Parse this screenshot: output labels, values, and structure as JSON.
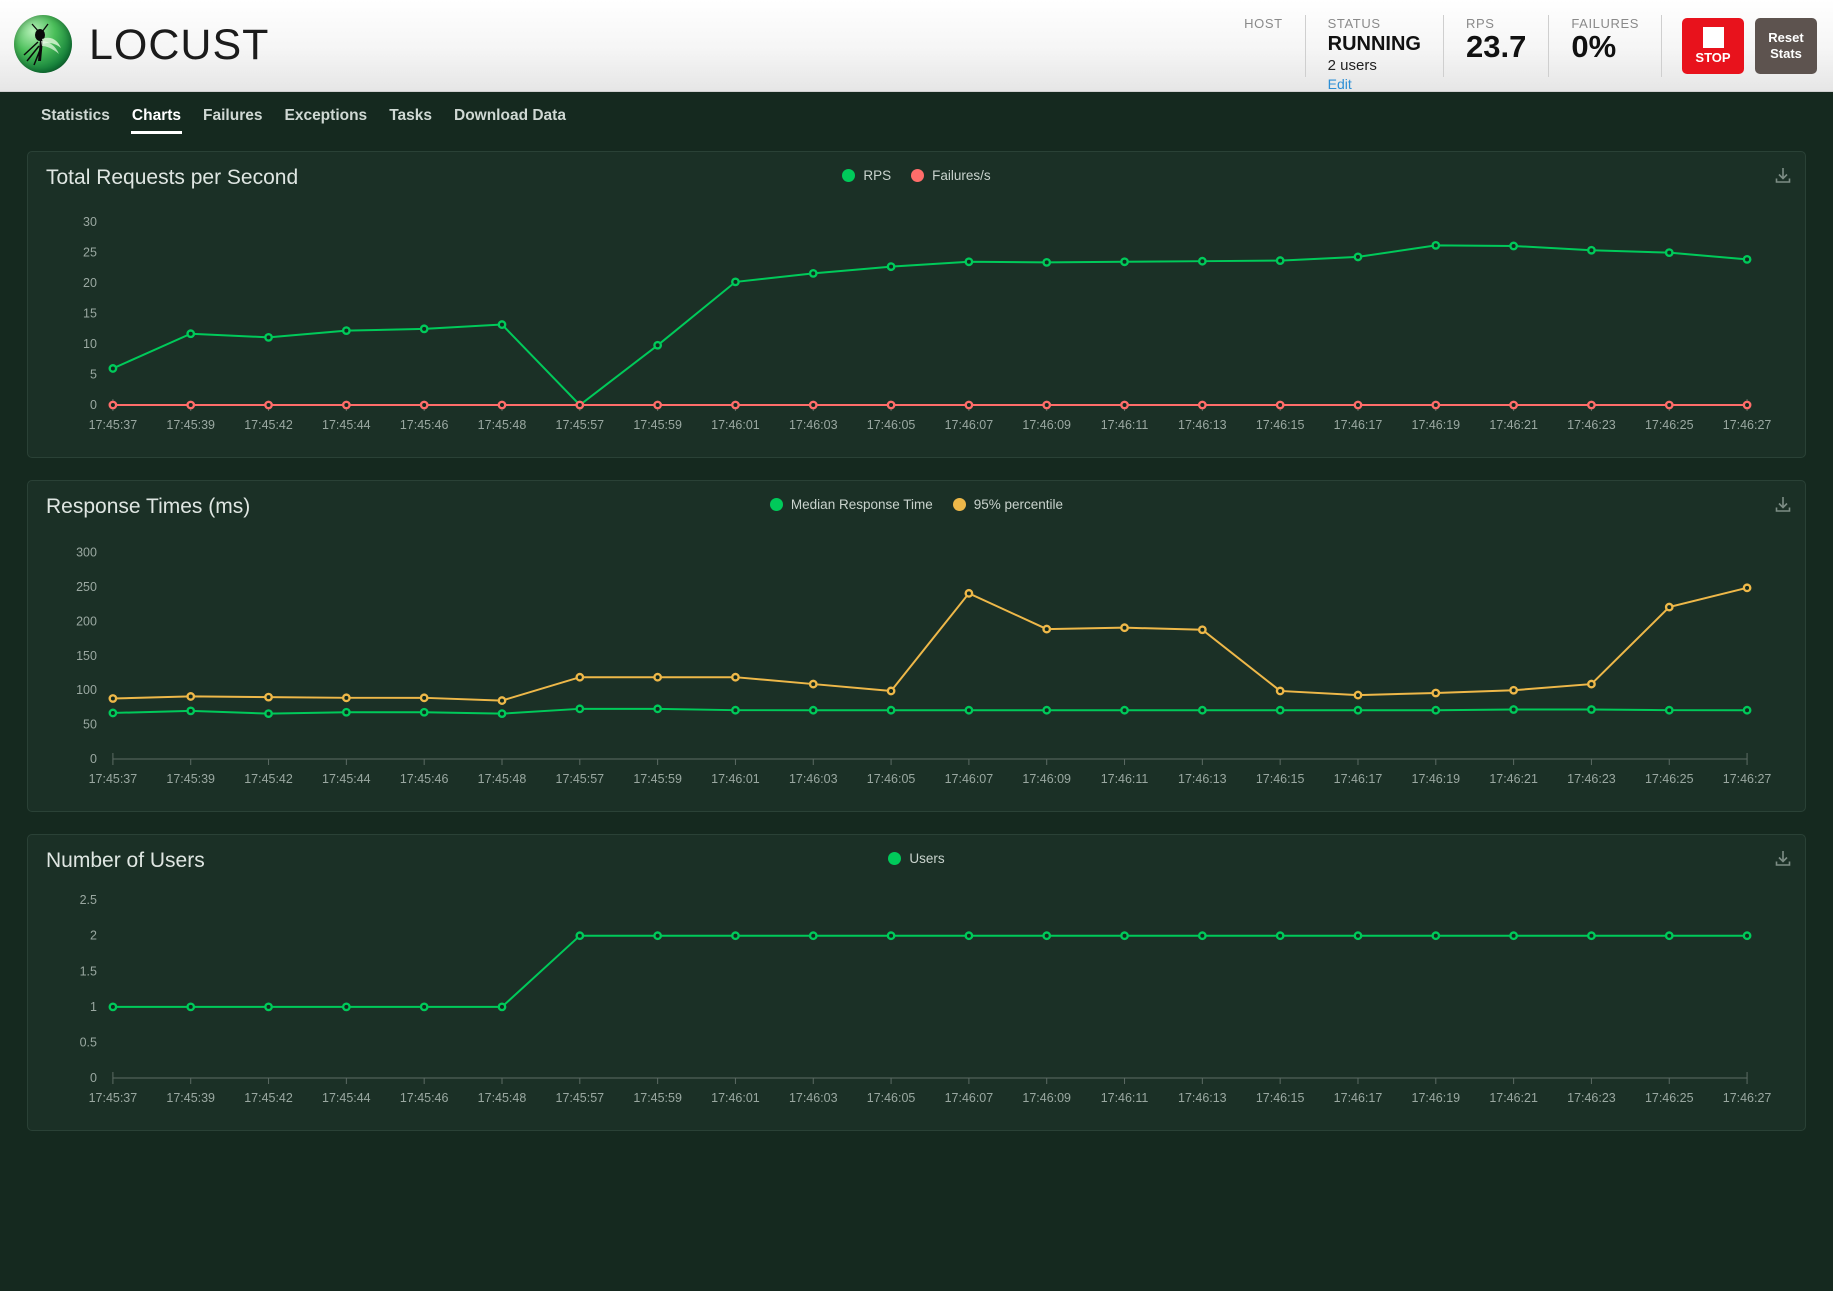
{
  "app": {
    "brand_name": "LOCUST",
    "logo_icon": "locust-logo-icon"
  },
  "header": {
    "host": {
      "label": "HOST",
      "value": ""
    },
    "status": {
      "label": "STATUS",
      "value": "RUNNING",
      "users": "2 users",
      "edit_link": "Edit"
    },
    "rps": {
      "label": "RPS",
      "value": "23.7"
    },
    "failures": {
      "label": "FAILURES",
      "value": "0%"
    },
    "stop_button": "STOP",
    "reset_button": "Reset Stats"
  },
  "nav": {
    "items": [
      {
        "label": "Statistics",
        "active": false
      },
      {
        "label": "Charts",
        "active": true
      },
      {
        "label": "Failures",
        "active": false
      },
      {
        "label": "Exceptions",
        "active": false
      },
      {
        "label": "Tasks",
        "active": false
      },
      {
        "label": "Download Data",
        "active": false
      }
    ]
  },
  "colors": {
    "rps_green": "#00ca5a",
    "failures_red": "#ff6d6a",
    "percentile_yellow": "#eeb849",
    "panel_bg": "#1b3026",
    "page_bg": "#15291f",
    "axis": "#9aa8a1"
  },
  "icons": {
    "download": "download-icon"
  },
  "chart_data": [
    {
      "type": "line",
      "title": "Total Requests per Second",
      "xlabel": "",
      "ylabel": "",
      "ylim": [
        0,
        32
      ],
      "yticks": [
        0,
        5,
        10,
        15,
        20,
        25,
        30
      ],
      "grid": false,
      "legend_position": "top-center",
      "categories": [
        "17:45:37",
        "17:45:39",
        "17:45:42",
        "17:45:44",
        "17:45:46",
        "17:45:48",
        "17:45:57",
        "17:45:59",
        "17:46:01",
        "17:46:03",
        "17:46:05",
        "17:46:07",
        "17:46:09",
        "17:46:11",
        "17:46:13",
        "17:46:15",
        "17:46:17",
        "17:46:19",
        "17:46:21",
        "17:46:23",
        "17:46:25",
        "17:46:27"
      ],
      "series": [
        {
          "name": "RPS",
          "color": "#00ca5a",
          "values": [
            6.0,
            11.7,
            11.1,
            12.2,
            12.5,
            13.2,
            0.0,
            9.8,
            20.2,
            21.6,
            22.7,
            23.5,
            23.4,
            23.5,
            23.6,
            23.7,
            24.3,
            26.2,
            26.1,
            25.4,
            25.0,
            23.9
          ]
        },
        {
          "name": "Failures/s",
          "color": "#ff6d6a",
          "values": [
            0,
            0,
            0,
            0,
            0,
            0,
            0,
            0,
            0,
            0,
            0,
            0,
            0,
            0,
            0,
            0,
            0,
            0,
            0,
            0,
            0,
            0
          ]
        }
      ]
    },
    {
      "type": "line",
      "title": "Response Times (ms)",
      "xlabel": "",
      "ylabel": "",
      "ylim": [
        0,
        320
      ],
      "yticks": [
        0,
        50,
        100,
        150,
        200,
        250,
        300
      ],
      "grid": false,
      "legend_position": "top-center",
      "categories": [
        "17:45:37",
        "17:45:39",
        "17:45:42",
        "17:45:44",
        "17:45:46",
        "17:45:48",
        "17:45:57",
        "17:45:59",
        "17:46:01",
        "17:46:03",
        "17:46:05",
        "17:46:07",
        "17:46:09",
        "17:46:11",
        "17:46:13",
        "17:46:15",
        "17:46:17",
        "17:46:19",
        "17:46:21",
        "17:46:23",
        "17:46:25",
        "17:46:27"
      ],
      "series": [
        {
          "name": "Median Response Time",
          "color": "#00ca5a",
          "values": [
            67,
            70,
            66,
            68,
            68,
            66,
            73,
            73,
            71,
            71,
            71,
            71,
            71,
            71,
            71,
            71,
            71,
            71,
            72,
            72,
            71,
            71
          ]
        },
        {
          "name": "95% percentile",
          "color": "#eeb849",
          "values": [
            88,
            91,
            90,
            89,
            89,
            85,
            119,
            119,
            119,
            109,
            99,
            241,
            189,
            191,
            188,
            99,
            93,
            96,
            100,
            109,
            221,
            249
          ]
        }
      ]
    },
    {
      "type": "line",
      "title": "Number of Users",
      "xlabel": "",
      "ylabel": "",
      "ylim": [
        0,
        2.6
      ],
      "yticks": [
        0,
        0.5,
        1,
        1.5,
        2,
        2.5
      ],
      "ytick_labels": [
        "0",
        "0.5",
        "1",
        "1.5",
        "2",
        "2.5"
      ],
      "grid": false,
      "legend_position": "top-center",
      "categories": [
        "17:45:37",
        "17:45:39",
        "17:45:42",
        "17:45:44",
        "17:45:46",
        "17:45:48",
        "17:45:57",
        "17:45:59",
        "17:46:01",
        "17:46:03",
        "17:46:05",
        "17:46:07",
        "17:46:09",
        "17:46:11",
        "17:46:13",
        "17:46:15",
        "17:46:17",
        "17:46:19",
        "17:46:21",
        "17:46:23",
        "17:46:25",
        "17:46:27"
      ],
      "series": [
        {
          "name": "Users",
          "color": "#00ca5a",
          "values": [
            1,
            1,
            1,
            1,
            1,
            1,
            2,
            2,
            2,
            2,
            2,
            2,
            2,
            2,
            2,
            2,
            2,
            2,
            2,
            2,
            2,
            2
          ]
        }
      ]
    }
  ]
}
